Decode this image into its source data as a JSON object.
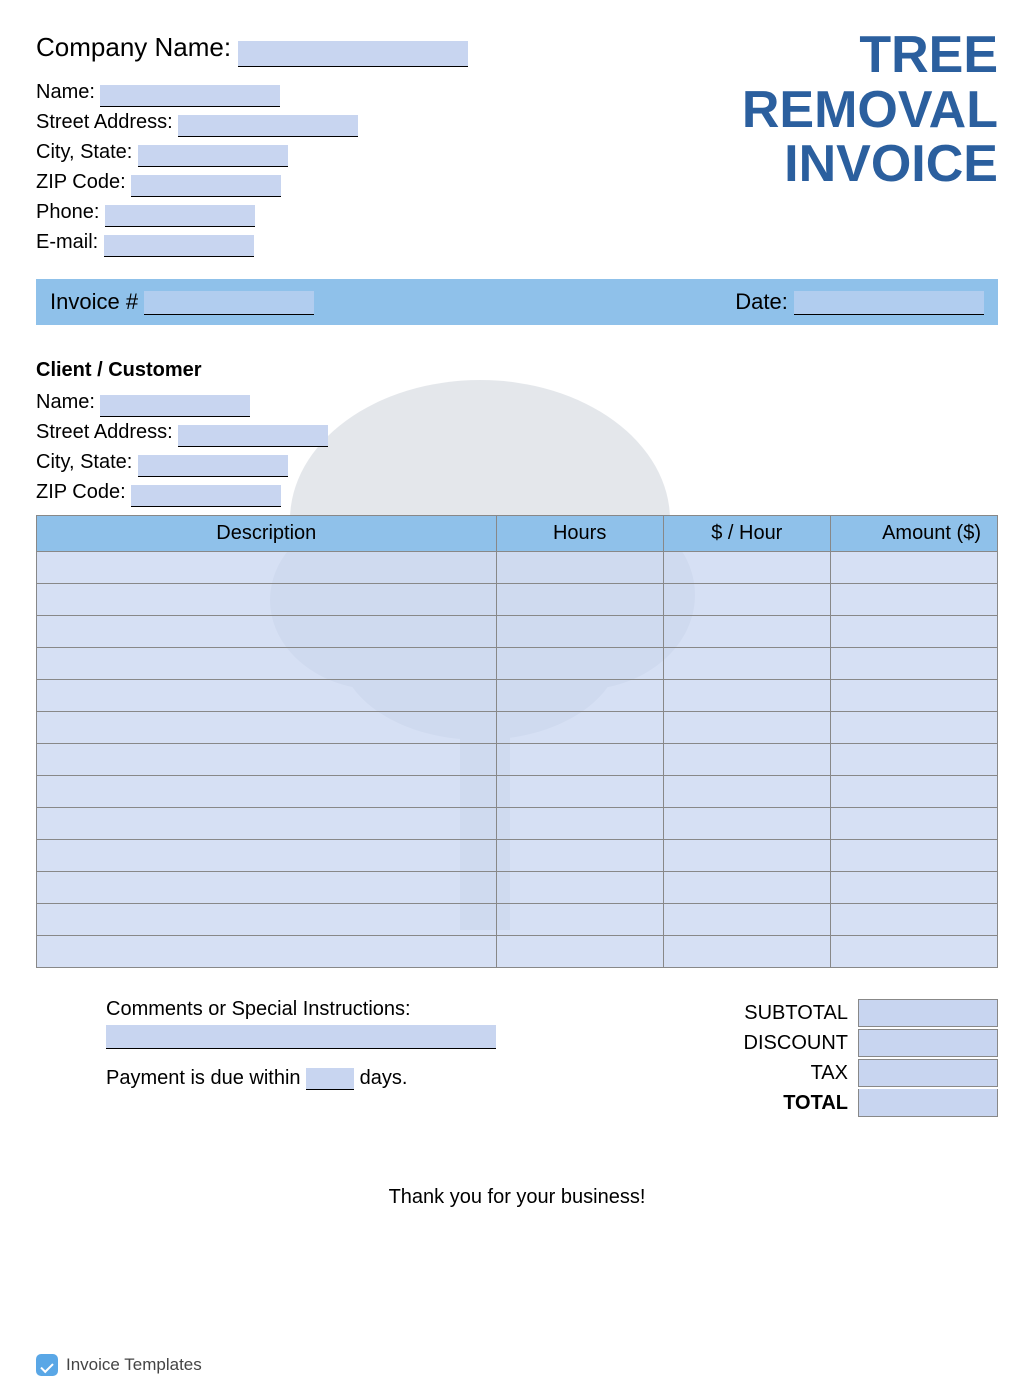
{
  "title": {
    "line1": "TREE",
    "line2": "REMOVAL",
    "line3": "INVOICE"
  },
  "company": {
    "company_name_label": "Company Name:",
    "company_name_value": "",
    "name_label": "Name:",
    "name_value": "",
    "street_label": "Street Address:",
    "street_value": "",
    "city_state_label": "City, State:",
    "city_state_value": "",
    "zip_label": "ZIP Code:",
    "zip_value": "",
    "phone_label": "Phone:",
    "phone_value": "",
    "email_label": "E-mail:",
    "email_value": ""
  },
  "invoice_bar": {
    "invoice_num_label": "Invoice #",
    "invoice_num_value": "",
    "date_label": "Date:",
    "date_value": ""
  },
  "client": {
    "heading": "Client / Customer",
    "name_label": "Name:",
    "name_value": "",
    "street_label": "Street Address:",
    "street_value": "",
    "city_state_label": "City, State:",
    "city_state_value": "",
    "zip_label": "ZIP Code:",
    "zip_value": ""
  },
  "table": {
    "headers": {
      "description": "Description",
      "hours": "Hours",
      "rate": "$ / Hour",
      "amount": "Amount ($)"
    },
    "rows": [
      {
        "description": "",
        "hours": "",
        "rate": "",
        "amount": ""
      },
      {
        "description": "",
        "hours": "",
        "rate": "",
        "amount": ""
      },
      {
        "description": "",
        "hours": "",
        "rate": "",
        "amount": ""
      },
      {
        "description": "",
        "hours": "",
        "rate": "",
        "amount": ""
      },
      {
        "description": "",
        "hours": "",
        "rate": "",
        "amount": ""
      },
      {
        "description": "",
        "hours": "",
        "rate": "",
        "amount": ""
      },
      {
        "description": "",
        "hours": "",
        "rate": "",
        "amount": ""
      },
      {
        "description": "",
        "hours": "",
        "rate": "",
        "amount": ""
      },
      {
        "description": "",
        "hours": "",
        "rate": "",
        "amount": ""
      },
      {
        "description": "",
        "hours": "",
        "rate": "",
        "amount": ""
      },
      {
        "description": "",
        "hours": "",
        "rate": "",
        "amount": ""
      },
      {
        "description": "",
        "hours": "",
        "rate": "",
        "amount": ""
      },
      {
        "description": "",
        "hours": "",
        "rate": "",
        "amount": ""
      }
    ]
  },
  "comments": {
    "label": "Comments or Special Instructions:",
    "value": "",
    "payment_prefix": "Payment is due within",
    "payment_days": "",
    "payment_suffix": "days."
  },
  "totals": {
    "subtotal_label": "SUBTOTAL",
    "subtotal_value": "",
    "discount_label": "DISCOUNT",
    "discount_value": "",
    "tax_label": "TAX",
    "tax_value": "",
    "total_label": "TOTAL",
    "total_value": ""
  },
  "thanks": "Thank you for your business!",
  "footer": "Invoice Templates"
}
